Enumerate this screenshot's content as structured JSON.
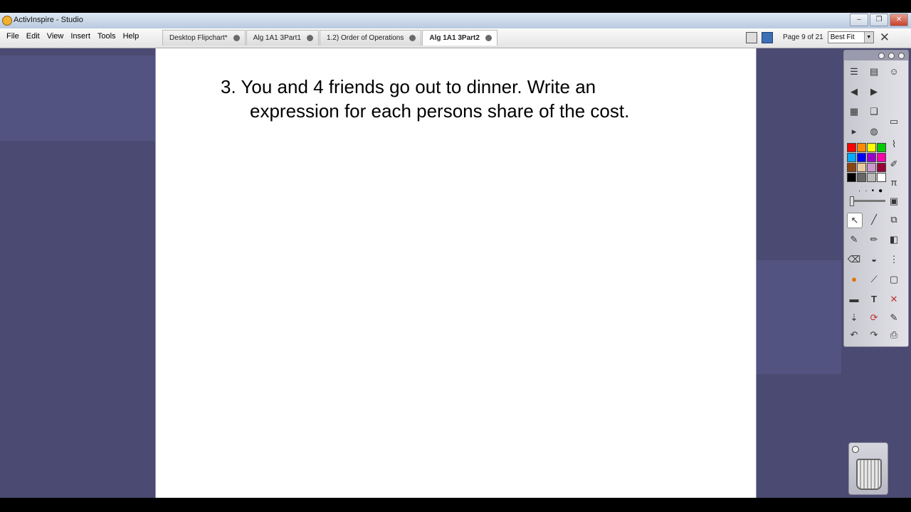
{
  "window": {
    "title": "ActivInspire - Studio",
    "controls": [
      "‒",
      "❐",
      "✕"
    ]
  },
  "menus": [
    "File",
    "Edit",
    "View",
    "Insert",
    "Tools",
    "Help"
  ],
  "tabs": [
    {
      "label": "Desktop Flipchart*",
      "active": false
    },
    {
      "label": "Alg 1A1 3Part1",
      "active": false
    },
    {
      "label": "1.2) Order of Operations",
      "active": false
    },
    {
      "label": "Alg 1A1 3Part2",
      "active": true
    }
  ],
  "page_indicator": "Page 9 of 21",
  "zoom": {
    "value": "Best Fit"
  },
  "content": {
    "question_line1": "3. You and 4 friends go out to dinner. Write an",
    "question_line2": "expression for each persons share of the cost."
  },
  "colors": {
    "workspace_bg": "#4a4a72",
    "palette": [
      "#ff0000",
      "#ff8a00",
      "#ffff00",
      "#00cc00",
      "#00aaff",
      "#0000ff",
      "#9900cc",
      "#ff00aa",
      "#8b4513",
      "#e8c9a0",
      "#cc99cc",
      "#990033",
      "#000000",
      "#666666",
      "#bbbbbb",
      "#ffffff"
    ]
  },
  "icons": [
    "application-icon",
    "page-view-icon",
    "page-browser-icon",
    "close-flipchart-icon",
    "select-icon",
    "pen-icon",
    "highlighter-icon",
    "eraser-icon",
    "shape-icon",
    "text-icon",
    "undo-icon",
    "redo-icon",
    "trash-icon",
    "zoom-dropdown-icon"
  ]
}
